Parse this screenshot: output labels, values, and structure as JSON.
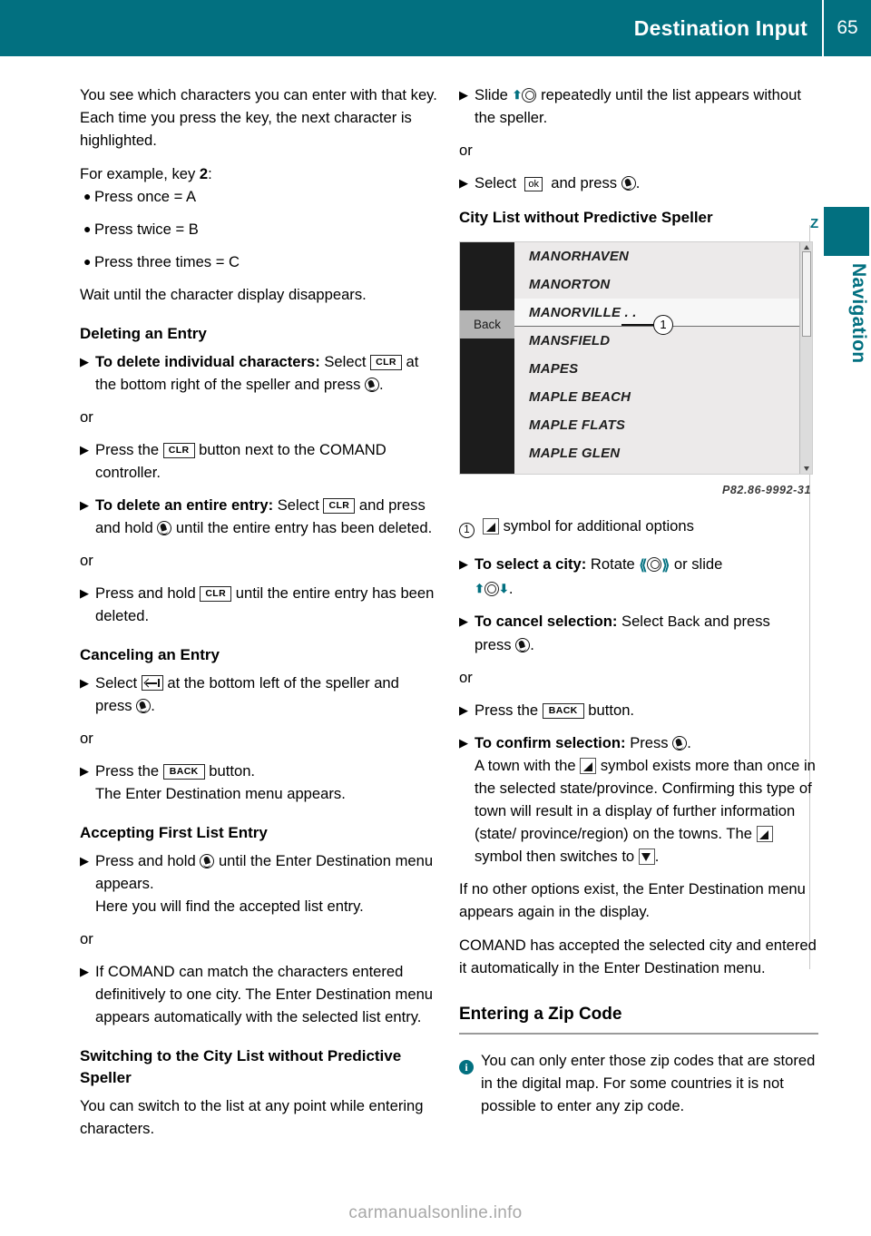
{
  "header": {
    "title": "Destination Input",
    "page_number": "65"
  },
  "side_tab": {
    "label": "Navigation",
    "bookmark_letter": "Z"
  },
  "left_column": {
    "intro_paragraph": "You see which characters you can enter with that key. Each time you press the key, the next character is highlighted.",
    "example_lead_prefix": "For example, key ",
    "example_lead_key": "2",
    "example_lead_suffix": ":",
    "bullets": [
      "Press once = A",
      "Press twice = B",
      "Press three times = C"
    ],
    "wait_paragraph": "Wait until the character display disappears.",
    "deleting_heading": "Deleting an Entry",
    "delete_individual_bold": "To delete individual characters:",
    "delete_individual_text_1": " Select",
    "delete_individual_key": "CLR",
    "delete_individual_text_2": "at the bottom right of the speller and press",
    "or_1": "or",
    "press_clr_text_1": "Press the",
    "press_clr_key": "CLR",
    "press_clr_text_2": "button. COMAND controller.",
    "press_clr_text_2a": "button next to the",
    "press_clr_text_2b": "COMAND controller.",
    "delete_entire_bold": "To delete an entire entry:",
    "delete_entire_text_1": " Select",
    "delete_entire_key": "CLR",
    "delete_entire_text_2": "and press and hold",
    "delete_entire_text_3": "until the entire entry has been deleted.",
    "or_2": "or",
    "hold_clr_text_1": "Press and hold",
    "hold_clr_key": "CLR",
    "hold_clr_text_2": "until the entire entry has been deleted.",
    "canceling_heading": "Canceling an Entry",
    "cancel_text_1": "Select",
    "cancel_text_2": "at the bottom left of the speller and press",
    "or_3": "or",
    "back_button_text_1": "Press the",
    "back_button_key": "BACK",
    "back_button_text_2": "button.",
    "back_button_result": "The Enter Destination menu appears.",
    "accepting_heading": "Accepting First List Entry",
    "accept_text_1": "Press and hold",
    "accept_text_2": "until the Enter Destination menu appears.",
    "accept_result": "Here you will find the accepted list entry.",
    "or_4": "or",
    "comand_match_text": "If COMAND can match the characters entered definitively to one city. The Enter Destination menu appears automatically with the selected list entry.",
    "switching_heading": "Switching to the City List without Predictive Speller",
    "switching_paragraph": "You can switch to the list at any point while entering characters."
  },
  "right_column": {
    "slide_text_1": "Slide",
    "slide_text_2": "repeatedly until the list appears without the speller.",
    "or_1": "or",
    "select_ok_text_1": "Select",
    "select_ok_key": "ok",
    "select_ok_text_2": "and press",
    "city_list_heading": "City List without Predictive Speller",
    "figure": {
      "back_label": "Back",
      "rows": [
        "MANORHAVEN",
        "MANORTON",
        "MANORVILLE . .",
        "MANSFIELD",
        "MAPES",
        "MAPLE BEACH",
        "MAPLE FLATS",
        "MAPLE GLEN"
      ],
      "selected_row_index": 2,
      "callout_number": "1",
      "caption": "P82.86-9992-31"
    },
    "legend_number": "1",
    "legend_text": "symbol for additional options",
    "select_city_bold": "To select a city:",
    "select_city_text_1": " Rotate",
    "select_city_text_2": "or slide",
    "cancel_selection_bold": "To cancel selection:",
    "cancel_selection_text_1": " Select",
    "cancel_selection_value": "Back",
    "cancel_selection_text_2": "and press",
    "or_2": "or",
    "press_back_text_1": "Press the",
    "press_back_key": "BACK",
    "press_back_text_2": "button.",
    "confirm_bold": "To confirm selection:",
    "confirm_text_1": " Press",
    "confirm_detail_1": "A town with the",
    "confirm_detail_2": "symbol exists more than once in the selected state/province. Confirming this type of town will result in a display of further information (state/ province/region) on the towns. The",
    "confirm_detail_3": "symbol then switches to",
    "no_options_paragraph": "If no other options exist, the Enter Destination menu appears again in the display.",
    "comand_accepted_paragraph": "COMAND has accepted the selected city and entered it automatically in the Enter Destination menu.",
    "zip_heading": "Entering a Zip Code",
    "zip_note": "You can only enter those zip codes that are stored in the digital map. For some countries it is not possible to enter any zip code."
  },
  "footer": {
    "watermark": "carmanualsonline.info"
  },
  "colors": {
    "brand_teal": "#027080",
    "header_text": "#ffffff",
    "watermark_gray": "#a8a8a8"
  },
  "icons": {
    "step_marker": "▶",
    "bullet_dot": "●"
  }
}
